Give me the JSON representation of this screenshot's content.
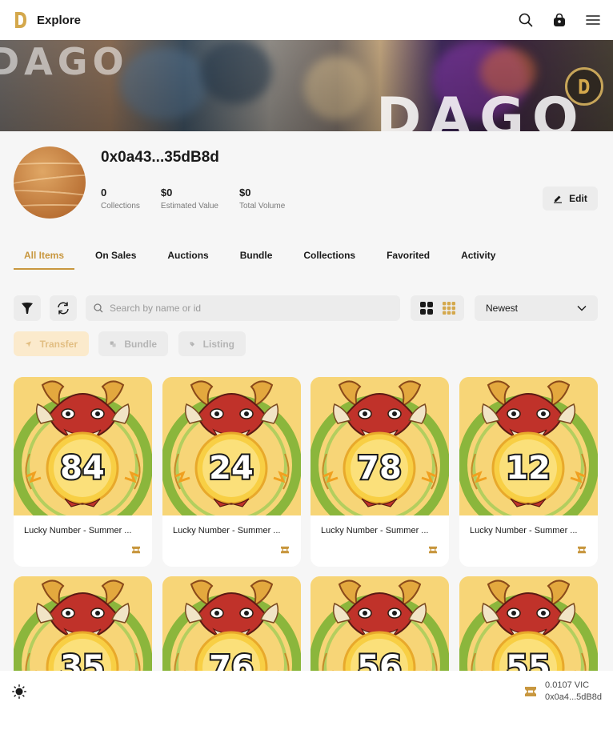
{
  "header": {
    "title": "Explore",
    "icons": [
      "search-icon",
      "bag-icon",
      "menu-icon"
    ]
  },
  "banner": {
    "text": "DAGO",
    "text_left": "DAGO"
  },
  "profile": {
    "address": "0x0a43...35dB8d",
    "stats": [
      {
        "value": "0",
        "label": "Collections"
      },
      {
        "value": "$0",
        "label": "Estimated Value"
      },
      {
        "value": "$0",
        "label": "Total Volume"
      }
    ],
    "edit_label": "Edit"
  },
  "tabs": [
    {
      "label": "All Items",
      "active": true
    },
    {
      "label": "On Sales",
      "active": false
    },
    {
      "label": "Auctions",
      "active": false
    },
    {
      "label": "Bundle",
      "active": false
    },
    {
      "label": "Collections",
      "active": false
    },
    {
      "label": "Favorited",
      "active": false
    },
    {
      "label": "Activity",
      "active": false
    }
  ],
  "toolbar": {
    "search_placeholder": "Search by name or id",
    "sort_value": "Newest",
    "actions": {
      "transfer": "Transfer",
      "bundle": "Bundle",
      "listing": "Listing"
    }
  },
  "items": [
    {
      "number": "84",
      "title": "Lucky Number - Summer ..."
    },
    {
      "number": "24",
      "title": "Lucky Number - Summer ..."
    },
    {
      "number": "78",
      "title": "Lucky Number - Summer ..."
    },
    {
      "number": "12",
      "title": "Lucky Number - Summer ..."
    },
    {
      "number": "35",
      "title": ""
    },
    {
      "number": "76",
      "title": ""
    },
    {
      "number": "56",
      "title": ""
    },
    {
      "number": "55",
      "title": ""
    }
  ],
  "wallet": {
    "balance": "0.0107 VIC",
    "address": "0x0a4...5dB8d"
  },
  "colors": {
    "accent": "#c8973f",
    "card_bg": "#f7d577",
    "dragon_red": "#c0322a",
    "ring_green": "#8bb63c"
  }
}
